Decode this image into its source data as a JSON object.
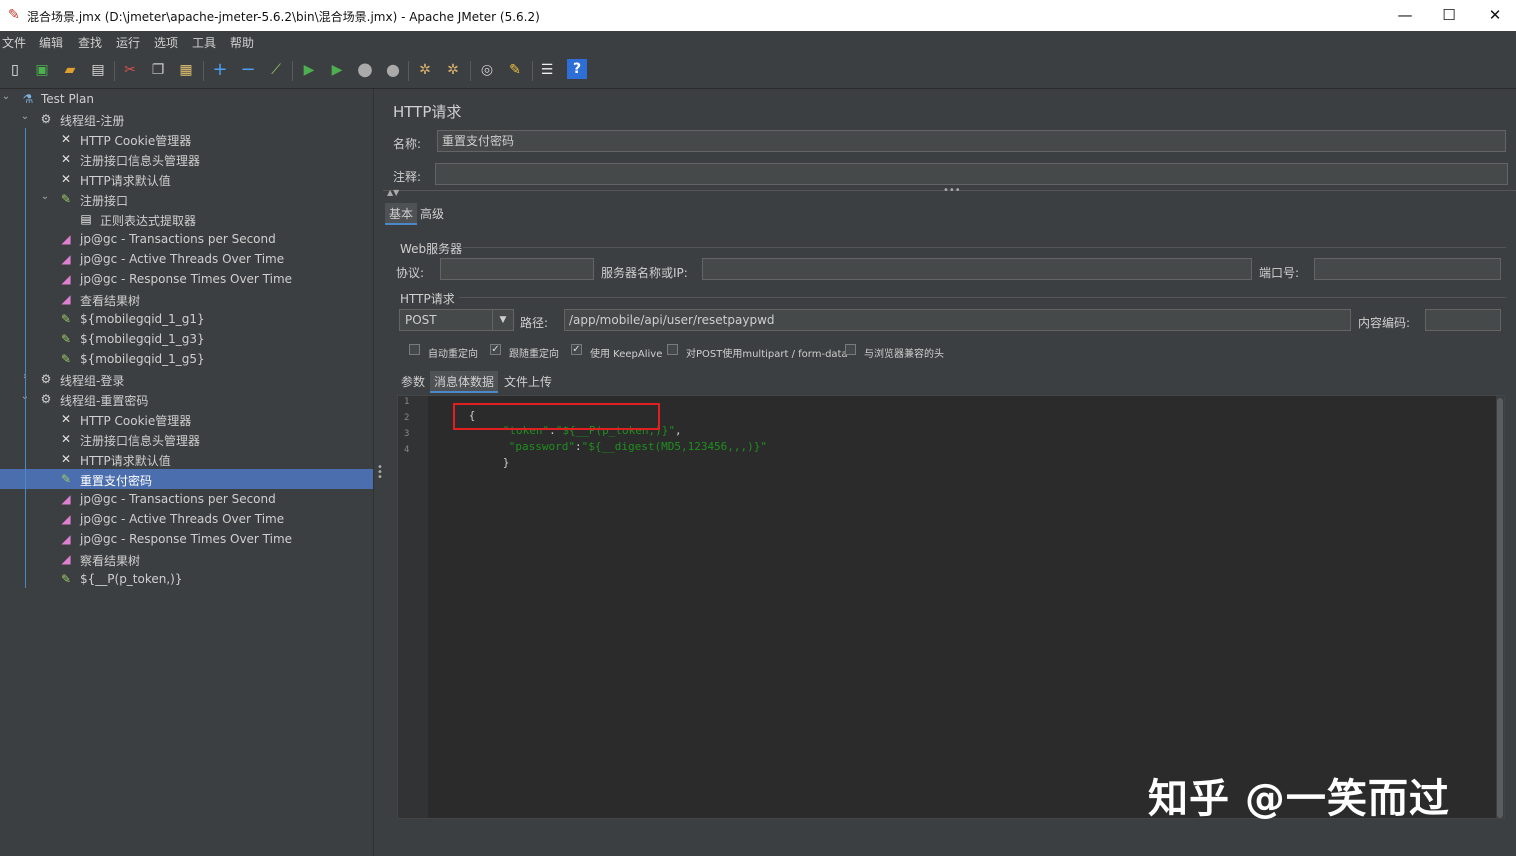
{
  "window": {
    "title": "混合场景.jmx (D:\\jmeter\\apache-jmeter-5.6.2\\bin\\混合场景.jmx) - Apache JMeter (5.6.2)",
    "minimize": "—",
    "maximize": "☐",
    "close": "✕"
  },
  "menu": [
    "文件",
    "编辑",
    "查找",
    "运行",
    "选项",
    "工具",
    "帮助"
  ],
  "toolbar": {
    "icons": [
      "new-icon",
      "templates-icon",
      "open-icon",
      "save-icon",
      "cut-icon",
      "copy-icon",
      "paste-icon",
      "expand-icon",
      "collapse-icon",
      "toggle-icon",
      "start-icon",
      "start-no-pause-icon",
      "stop-icon",
      "shutdown-icon",
      "clear-icon",
      "clear-all-icon",
      "search-icon",
      "reset-search-icon",
      "function-helper-icon",
      "help-icon"
    ]
  },
  "tree": [
    {
      "label": "Test Plan",
      "icon": "test-plan-icon",
      "level": 0,
      "arrow": "⌄"
    },
    {
      "label": "线程组-注册",
      "icon": "gear-icon",
      "level": 1,
      "arrow": "⌄"
    },
    {
      "label": "HTTP Cookie管理器",
      "icon": "config-tool-icon",
      "level": 2,
      "arrow": ""
    },
    {
      "label": "注册接口信息头管理器",
      "icon": "config-tool-icon",
      "level": 2,
      "arrow": ""
    },
    {
      "label": "HTTP请求默认值",
      "icon": "config-tool-icon",
      "level": 2,
      "arrow": ""
    },
    {
      "label": "注册接口",
      "icon": "sampler-pipette-icon",
      "level": 2,
      "arrow": "⌄"
    },
    {
      "label": "正则表达式提取器",
      "icon": "extractor-icon",
      "level": 3,
      "arrow": ""
    },
    {
      "label": "jp@gc - Transactions per Second",
      "icon": "graph-icon",
      "level": 2,
      "arrow": ""
    },
    {
      "label": "jp@gc - Active Threads Over Time",
      "icon": "graph-icon",
      "level": 2,
      "arrow": ""
    },
    {
      "label": "jp@gc - Response Times Over Time",
      "icon": "graph-icon",
      "level": 2,
      "arrow": ""
    },
    {
      "label": "查看结果树",
      "icon": "graph-icon",
      "level": 2,
      "arrow": ""
    },
    {
      "label": "${mobilegqid_1_g1}",
      "icon": "sampler-pipette-icon",
      "level": 2,
      "arrow": ""
    },
    {
      "label": "${mobilegqid_1_g3}",
      "icon": "sampler-pipette-icon",
      "level": 2,
      "arrow": ""
    },
    {
      "label": "${mobilegqid_1_g5}",
      "icon": "sampler-pipette-icon",
      "level": 2,
      "arrow": ""
    },
    {
      "label": "线程组-登录",
      "icon": "gear-icon",
      "level": 1,
      "arrow": "›"
    },
    {
      "label": "线程组-重置密码",
      "icon": "gear-icon",
      "level": 1,
      "arrow": "⌄"
    },
    {
      "label": "HTTP Cookie管理器",
      "icon": "config-tool-icon",
      "level": 2,
      "arrow": ""
    },
    {
      "label": "注册接口信息头管理器",
      "icon": "config-tool-icon",
      "level": 2,
      "arrow": ""
    },
    {
      "label": "HTTP请求默认值",
      "icon": "config-tool-icon",
      "level": 2,
      "arrow": ""
    },
    {
      "label": "重置支付密码",
      "icon": "sampler-pipette-icon",
      "level": 2,
      "arrow": "",
      "selected": true
    },
    {
      "label": "jp@gc - Transactions per Second",
      "icon": "graph-icon",
      "level": 2,
      "arrow": ""
    },
    {
      "label": "jp@gc - Active Threads Over Time",
      "icon": "graph-icon",
      "level": 2,
      "arrow": ""
    },
    {
      "label": "jp@gc - Response Times Over Time",
      "icon": "graph-icon",
      "level": 2,
      "arrow": ""
    },
    {
      "label": "察看结果树",
      "icon": "graph-icon",
      "level": 2,
      "arrow": ""
    },
    {
      "label": "${__P(p_token,)}",
      "icon": "sampler-pipette-icon",
      "level": 2,
      "arrow": ""
    }
  ],
  "panel": {
    "title": "HTTP请求",
    "name_label": "名称:",
    "name_value": "重置支付密码",
    "comment_label": "注释:",
    "comment_value": "",
    "tabs": [
      "基本",
      "高级"
    ],
    "web_server": {
      "group_title": "Web服务器",
      "protocol_label": "协议:",
      "protocol_value": "",
      "server_label": "服务器名称或IP:",
      "server_value": "",
      "port_label": "端口号:",
      "port_value": ""
    },
    "http_request": {
      "group_title": "HTTP请求",
      "method": "POST",
      "path_label": "路径:",
      "path_value": "/app/mobile/api/user/resetpaypwd",
      "encoding_label": "内容编码:",
      "encoding_value": ""
    },
    "checkboxes": [
      {
        "label": "自动重定向",
        "checked": false
      },
      {
        "label": "跟随重定向",
        "checked": true
      },
      {
        "label": "使用 KeepAlive",
        "checked": true
      },
      {
        "label": "对POST使用multipart / form-data",
        "checked": false
      },
      {
        "label": "与浏览器兼容的头",
        "checked": false
      }
    ],
    "body_tabs": [
      "参数",
      "消息体数据",
      "文件上传"
    ],
    "code_lines": [
      {
        "no": "1",
        "parts": [
          {
            "t": "{",
            "c": "punc"
          }
        ]
      },
      {
        "no": "2",
        "parts": [
          {
            "t": "\"token\"",
            "c": "str"
          },
          {
            "t": ":",
            "c": "punc"
          },
          {
            "t": "\"${__P(p_token,)}\"",
            "c": "str"
          },
          {
            "t": ",",
            "c": "punc"
          }
        ]
      },
      {
        "no": "3",
        "parts": [
          {
            "t": "\"password\"",
            "c": "str"
          },
          {
            "t": ":",
            "c": "punc"
          },
          {
            "t": "\"${__digest(MD5,123456,,,)}\"",
            "c": "str"
          }
        ]
      },
      {
        "no": "4",
        "parts": [
          {
            "t": "}",
            "c": "punc"
          }
        ]
      }
    ]
  },
  "watermark": "知乎 @一笑而过"
}
